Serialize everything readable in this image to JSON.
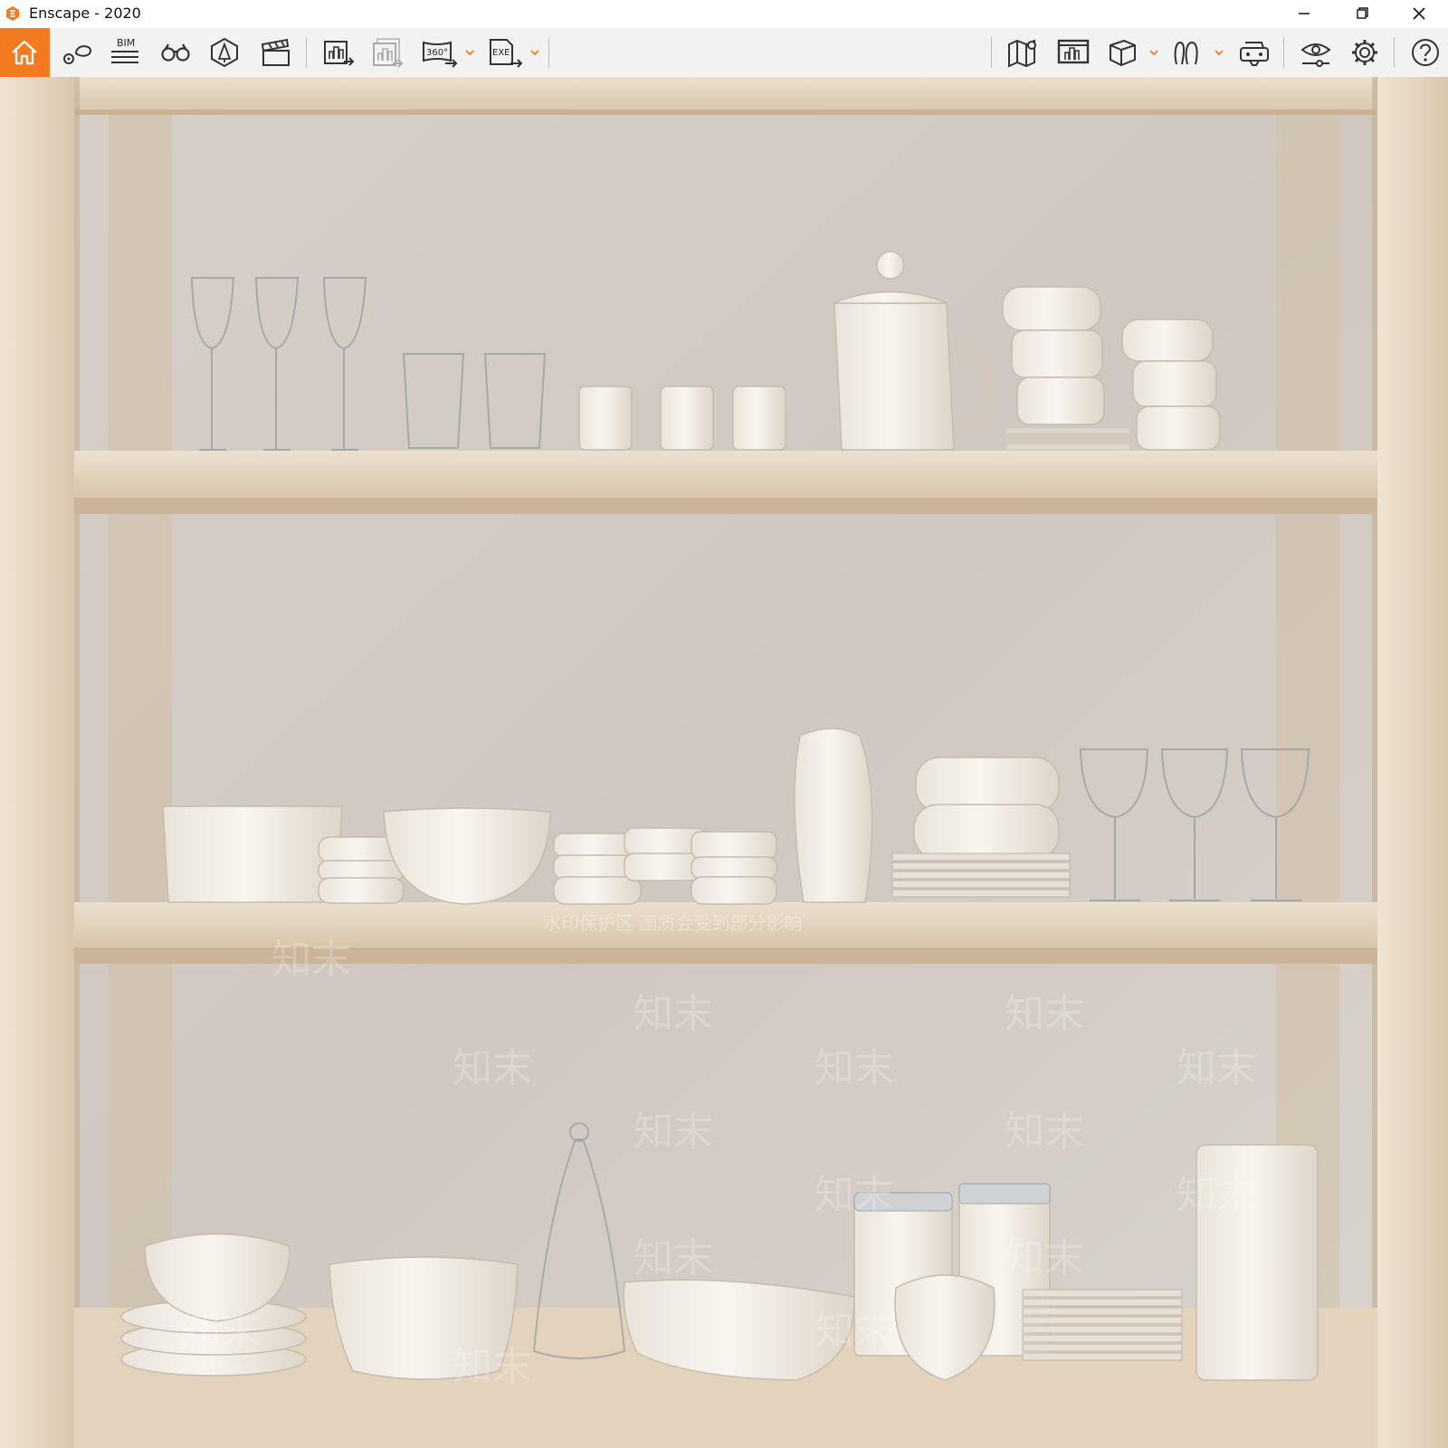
{
  "window": {
    "title": "Enscape - 2020",
    "accent_color": "#f47a20",
    "controls": [
      "minimize-icon",
      "restore-icon",
      "close-icon"
    ]
  },
  "toolbar": {
    "left_group": [
      {
        "name": "home-icon",
        "active": true
      },
      {
        "name": "views-icon"
      },
      {
        "name": "bim-icon",
        "label": "BIM"
      },
      {
        "name": "binoculars-icon"
      },
      {
        "name": "asset-library-icon"
      },
      {
        "name": "video-editor-icon"
      }
    ],
    "export_group": [
      {
        "name": "render-export-icon"
      },
      {
        "name": "batch-render-icon",
        "disabled": true
      },
      {
        "name": "panorama-export-icon",
        "label": "360°",
        "dropdown": true
      },
      {
        "name": "exe-export-icon",
        "label": "EXE",
        "dropdown": true
      }
    ],
    "right_group": [
      {
        "name": "map-icon"
      },
      {
        "name": "status-bar-icon"
      },
      {
        "name": "cube-icon",
        "dropdown": true
      },
      {
        "name": "people-icon",
        "dropdown": true
      },
      {
        "name": "vr-headset-icon"
      },
      {
        "name": "eye-visual-settings-icon"
      },
      {
        "name": "settings-gear-icon"
      },
      {
        "name": "help-icon"
      }
    ],
    "collapse_icon": "chevron-up-icon"
  },
  "viewport": {
    "scene": "render of wooden shelving with white ceramic tableware and glassware",
    "watermark_text": "知末",
    "watermark_note_text": "水印保护区  画质会受到部分影响"
  }
}
